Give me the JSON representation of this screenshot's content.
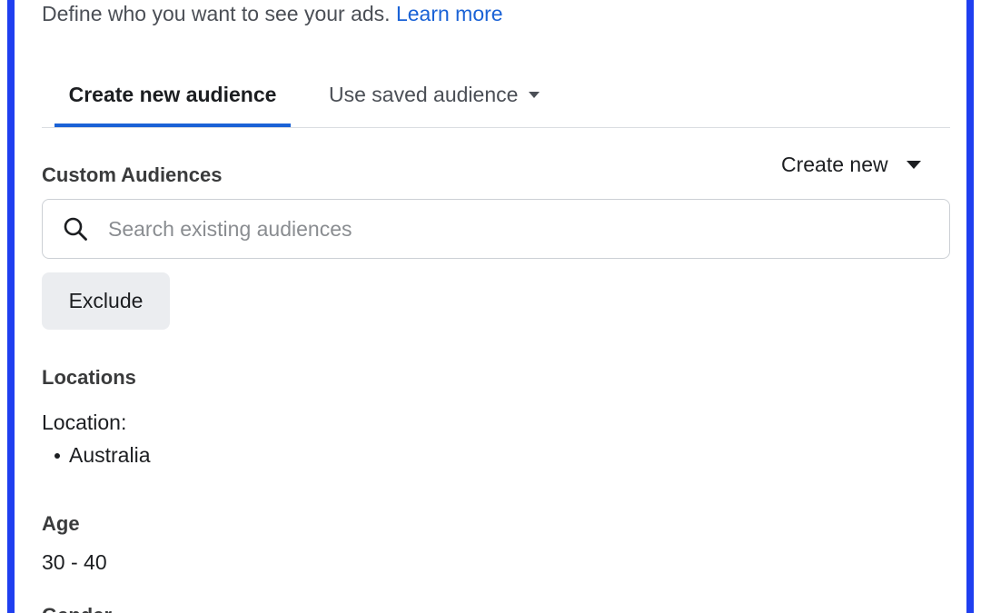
{
  "intro": {
    "text": "Define who you want to see your ads.",
    "link": "Learn more"
  },
  "tabs": {
    "create_new": "Create new audience",
    "use_saved": "Use saved audience"
  },
  "custom_audiences": {
    "title": "Custom Audiences",
    "create_new": "Create new",
    "search_placeholder": "Search existing audiences",
    "search_value": "",
    "exclude_label": "Exclude"
  },
  "locations": {
    "title": "Locations",
    "label": "Location:",
    "items": [
      "Australia"
    ]
  },
  "age": {
    "title": "Age",
    "value": "30 - 40"
  },
  "gender": {
    "title": "Gender"
  },
  "colors": {
    "accent": "#1a62d6",
    "frame_border": "#1f3ff0",
    "button_bg": "#ebedf0"
  },
  "icons": {
    "search": "search-icon",
    "tab_caret": "chevron-down-icon",
    "create_caret": "caret-down-icon"
  }
}
